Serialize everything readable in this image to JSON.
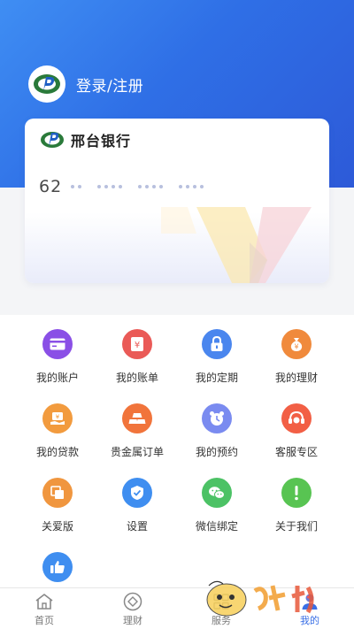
{
  "header": {
    "login_label": "登录/注册",
    "gradient_start": "#3f8ef3",
    "gradient_end": "#2d5ad8"
  },
  "card": {
    "bank_name": "邢台银行",
    "number_prefix": "62",
    "masked_groups": [
      2,
      4,
      4,
      4
    ]
  },
  "services": [
    {
      "id": "my-account",
      "label": "我的账户",
      "icon": "card-icon",
      "color": "#8a4fe6"
    },
    {
      "id": "my-bill",
      "label": "我的账单",
      "icon": "bill-icon",
      "color": "#ea5a57"
    },
    {
      "id": "my-deposit",
      "label": "我的定期",
      "icon": "lock-icon",
      "color": "#4a86ee"
    },
    {
      "id": "my-finance",
      "label": "我的理财",
      "icon": "money-bag-icon",
      "color": "#f08a3c"
    },
    {
      "id": "my-loan",
      "label": "我的贷款",
      "icon": "loan-icon",
      "color": "#f29b3e"
    },
    {
      "id": "precious-metal-order",
      "label": "贵金属订单",
      "icon": "gold-bars-icon",
      "color": "#f1743b"
    },
    {
      "id": "my-appointment",
      "label": "我的预约",
      "icon": "alarm-clock-icon",
      "color": "#7a8bf0"
    },
    {
      "id": "customer-service",
      "label": "客服专区",
      "icon": "headset-icon",
      "color": "#f25f45"
    },
    {
      "id": "care-version",
      "label": "关爱版",
      "icon": "layers-icon",
      "color": "#f0963f"
    },
    {
      "id": "settings",
      "label": "设置",
      "icon": "shield-check-icon",
      "color": "#3f8ef0"
    },
    {
      "id": "wechat-bind",
      "label": "微信绑定",
      "icon": "wechat-icon",
      "color": "#4cc265"
    },
    {
      "id": "about-us",
      "label": "关于我们",
      "icon": "exclamation-icon",
      "color": "#58c452"
    },
    {
      "id": "feedback",
      "label": "",
      "icon": "thumbs-up-icon",
      "color": "#3f8ef0"
    }
  ],
  "tabbar": {
    "tabs": [
      {
        "id": "home",
        "label": "首页",
        "icon": "home-icon",
        "active": false
      },
      {
        "id": "finance",
        "label": "理财",
        "icon": "diamond-icon",
        "active": false
      },
      {
        "id": "service",
        "label": "服务",
        "icon": "grid-icon",
        "active": false
      },
      {
        "id": "mine",
        "label": "我的",
        "icon": "person-icon",
        "active": true
      }
    ],
    "active_color": "#3a6fe6"
  }
}
